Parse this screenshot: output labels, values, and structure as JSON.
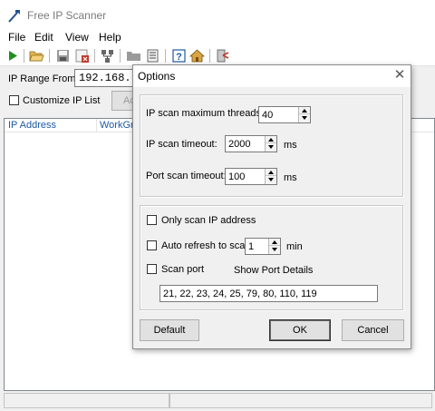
{
  "window": {
    "title": "Free IP Scanner",
    "icon": "scanner-wand-icon"
  },
  "menu": {
    "items": [
      "File",
      "Edit",
      "View",
      "Help"
    ]
  },
  "toolbar": {
    "buttons": [
      {
        "name": "start-scan-button",
        "icon": "play-icon",
        "color": "#1f8f1f"
      },
      {
        "name": "open-button",
        "icon": "folder-open-icon"
      },
      {
        "name": "save-button",
        "icon": "save-icon"
      },
      {
        "name": "export-button",
        "icon": "export-icon"
      },
      {
        "name": "network-button",
        "icon": "network-icon"
      },
      {
        "name": "folder-button",
        "icon": "folder-icon"
      },
      {
        "name": "list-button",
        "icon": "list-icon"
      },
      {
        "name": "help-button",
        "icon": "help-icon",
        "color": "#1f5aa6"
      },
      {
        "name": "home-button",
        "icon": "home-icon"
      },
      {
        "name": "exit-button",
        "icon": "exit-icon"
      }
    ]
  },
  "scan_panel": {
    "range_label": "IP Range From",
    "range_from": "192.168.",
    "customize_label": "Customize IP List",
    "customize_checked": false,
    "add_button_label": "Ad"
  },
  "results": {
    "columns": [
      "IP Address",
      "WorkGro"
    ]
  },
  "dialog": {
    "title": "Options",
    "max_threads_label": "IP scan maximum threads:",
    "max_threads_value": "40",
    "ip_timeout_label": "IP scan timeout:",
    "ip_timeout_value": "2000",
    "ip_timeout_unit": "ms",
    "port_timeout_label": "Port scan timeout:",
    "port_timeout_value": "100",
    "port_timeout_unit": "ms",
    "only_scan_ip_label": "Only scan IP address",
    "only_scan_ip_checked": false,
    "auto_refresh_label": "Auto refresh to scan",
    "auto_refresh_checked": false,
    "auto_refresh_value": "1",
    "auto_refresh_unit": "min",
    "scan_port_label": "Scan port",
    "scan_port_checked": false,
    "show_port_details_label": "Show Port Details",
    "ports": "21, 22, 23, 24, 25, 79, 80, 110, 119",
    "default_button": "Default",
    "ok_button": "OK",
    "cancel_button": "Cancel"
  }
}
